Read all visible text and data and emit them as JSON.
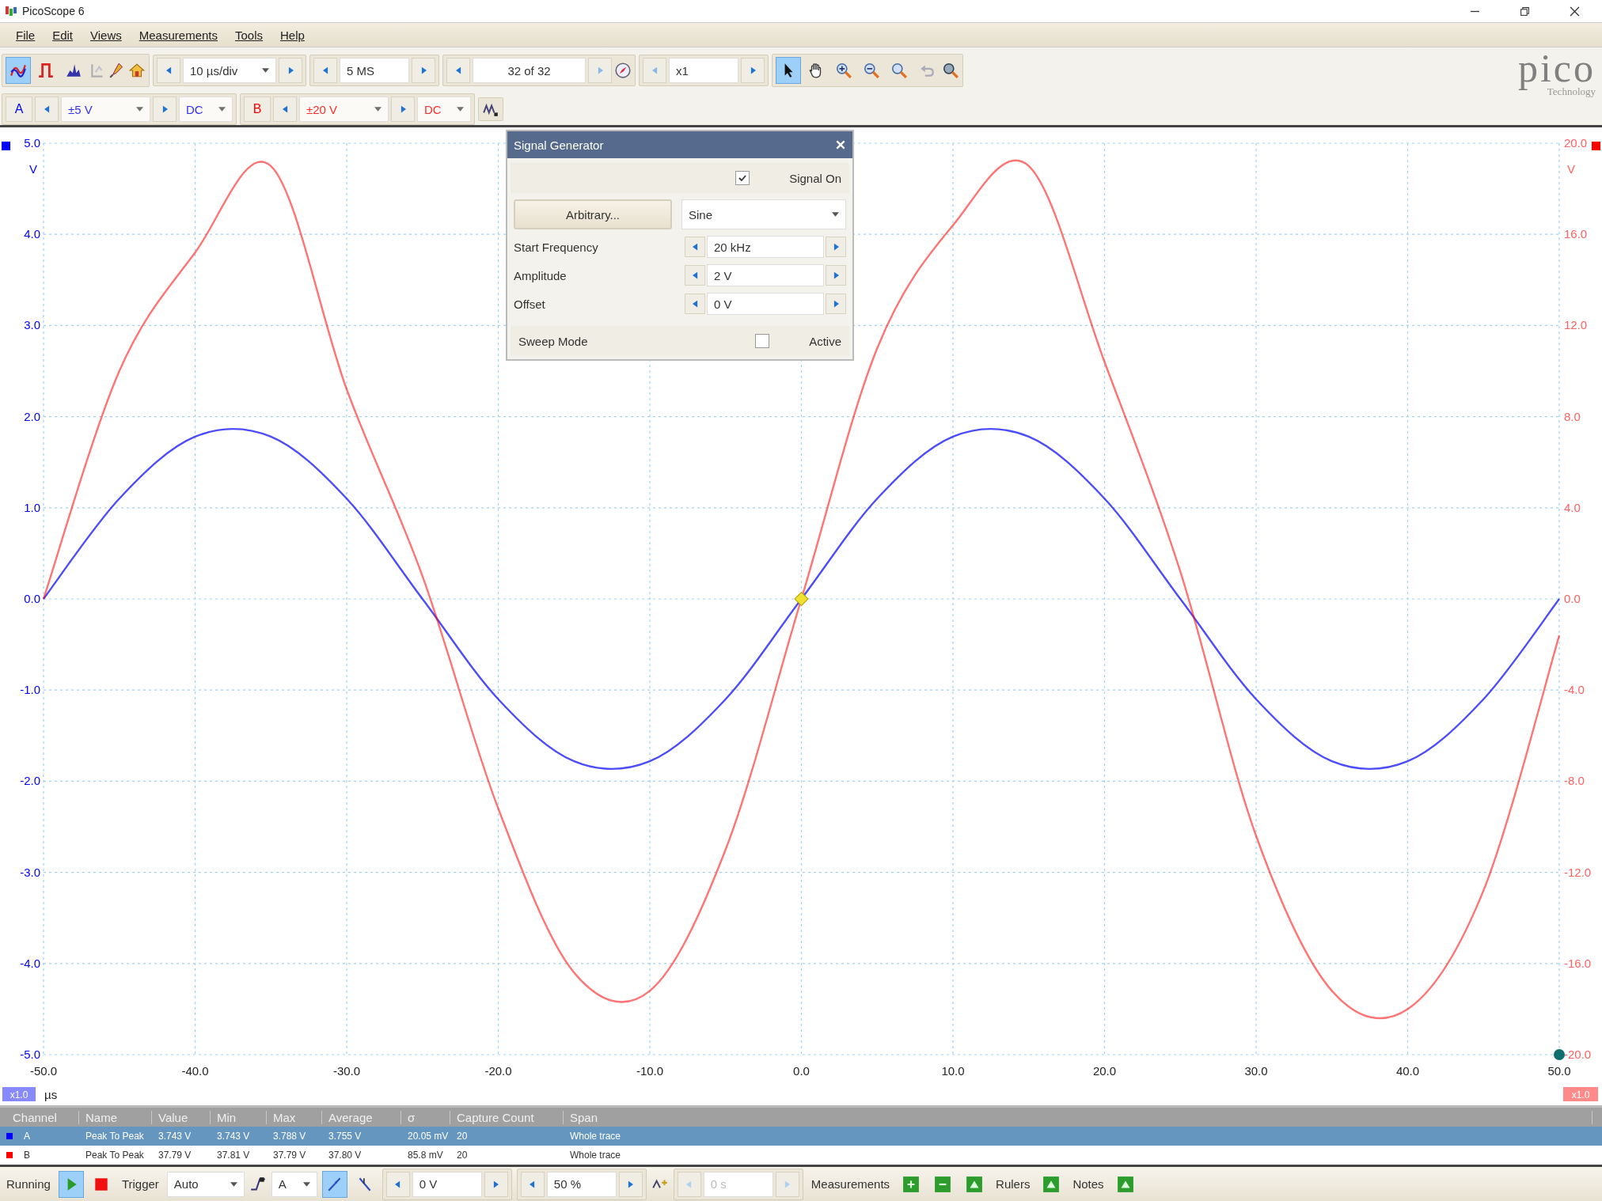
{
  "window": {
    "title": "PicoScope 6"
  },
  "menu": [
    "File",
    "Edit",
    "Views",
    "Measurements",
    "Tools",
    "Help"
  ],
  "toolbar": {
    "timebase": "10 µs/div",
    "samples": "5 MS",
    "buffer": "32 of 32",
    "zoom": "x1",
    "modes": [
      {
        "kind": "scope",
        "selected": true
      },
      {
        "kind": "persistence",
        "selected": false
      },
      {
        "kind": "spectrum",
        "selected": false
      }
    ],
    "tools": [
      {
        "kind": "pointer",
        "selected": true
      },
      {
        "kind": "hand",
        "selected": false
      },
      {
        "kind": "zoom-in",
        "selected": false
      },
      {
        "kind": "zoom-out",
        "selected": false
      },
      {
        "kind": "zoom-region",
        "selected": false
      },
      {
        "kind": "undo",
        "selected": false
      }
    ]
  },
  "logo": {
    "name": "pico",
    "tagline": "Technology"
  },
  "channels": [
    {
      "name": "A",
      "range": "±5 V",
      "coupling": "DC",
      "color": "#0000ff"
    },
    {
      "name": "B",
      "range": "±20 V",
      "coupling": "DC",
      "color": "#ff0000"
    }
  ],
  "signal_generator": {
    "title": "Signal Generator",
    "signal_on": {
      "label": "Signal On",
      "checked": true
    },
    "arbitrary_button": "Arbitrary...",
    "waveform": "Sine",
    "fields": [
      {
        "label": "Start Frequency",
        "value": "20 kHz"
      },
      {
        "label": "Amplitude",
        "value": "2 V"
      },
      {
        "label": "Offset",
        "value": "0 V"
      }
    ],
    "sweep": {
      "label": "Sweep Mode",
      "checkbox_label": "Active",
      "checked": false
    }
  },
  "graph": {
    "left_unit": "V",
    "right_unit": "V",
    "x_unit": "µs",
    "x_scale": "x1.0",
    "right_scale": "x1.0",
    "chart_data": {
      "type": "line",
      "x": [
        -50,
        -45,
        -40,
        -35,
        -30,
        -25,
        -20,
        -15,
        -10,
        -5,
        0,
        5,
        10,
        15,
        20,
        25,
        30,
        35,
        40,
        45,
        50
      ],
      "series": [
        {
          "color": "#0000ff",
          "values": [
            0,
            1.1,
            1.78,
            1.78,
            1.1,
            0,
            -1.1,
            -1.78,
            -1.78,
            -1.1,
            0,
            1.1,
            1.78,
            1.78,
            1.1,
            0,
            -1.1,
            -1.78,
            -1.78,
            -1.1,
            0
          ]
        },
        {
          "color": "#ff0000",
          "axis": "y2",
          "values": [
            0,
            10,
            15.2,
            19,
            9.2,
            1,
            -9.2,
            -16.4,
            -17.2,
            -11,
            0,
            11,
            16.4,
            19,
            10.4,
            1.2,
            -10.4,
            -17.2,
            -18,
            -12.8,
            -1.6
          ]
        }
      ],
      "grid": true,
      "xlim": [
        -50,
        50
      ],
      "ylim": [
        -5,
        5
      ],
      "y2lim": [
        -20,
        20
      ],
      "xticks": [
        {
          "value": -50,
          "label": "-50.0"
        },
        {
          "value": -40,
          "label": "-40.0"
        },
        {
          "value": -30,
          "label": "-30.0"
        },
        {
          "value": -20,
          "label": "-20.0"
        },
        {
          "value": -10,
          "label": "-10.0"
        },
        {
          "value": 0,
          "label": "0.0"
        },
        {
          "value": 10,
          "label": "10.0"
        },
        {
          "value": 20,
          "label": "20.0"
        },
        {
          "value": 30,
          "label": "30.0"
        },
        {
          "value": 40,
          "label": "40.0"
        },
        {
          "value": 50,
          "label": "50.0"
        }
      ],
      "yticks": [
        {
          "value": 5,
          "label": "5.0"
        },
        {
          "value": 4,
          "label": "4.0"
        },
        {
          "value": 3,
          "label": "3.0"
        },
        {
          "value": 2,
          "label": "2.0"
        },
        {
          "value": 1,
          "label": "1.0"
        },
        {
          "value": 0,
          "label": "0.0"
        },
        {
          "value": -1,
          "label": "-1.0"
        },
        {
          "value": -2,
          "label": "-2.0"
        },
        {
          "value": -3,
          "label": "-3.0"
        },
        {
          "value": -4,
          "label": "-4.0"
        },
        {
          "value": -5,
          "label": "-5.0"
        }
      ],
      "y2ticks": [
        {
          "value": 20,
          "label": "20.0"
        },
        {
          "value": 16,
          "label": "16.0"
        },
        {
          "value": 12,
          "label": "12.0"
        },
        {
          "value": 8,
          "label": "8.0"
        },
        {
          "value": 4,
          "label": "4.0"
        },
        {
          "value": 0,
          "label": "0.0"
        },
        {
          "value": -4,
          "label": "-4.0"
        },
        {
          "value": -8,
          "label": "-8.0"
        },
        {
          "value": -12,
          "label": "-12.0"
        },
        {
          "value": -16,
          "label": "-16.0"
        },
        {
          "value": -20,
          "label": "-20.0"
        }
      ]
    }
  },
  "measurements": {
    "columns": [
      "Channel",
      "Name",
      "Value",
      "Min",
      "Max",
      "Average",
      "σ",
      "Capture Count",
      "Span"
    ],
    "rows": [
      {
        "color": "#0000ff",
        "selected": true,
        "cells": [
          "A",
          "Peak To Peak",
          "3.743 V",
          "3.743 V",
          "3.788 V",
          "3.755 V",
          "20.05 mV",
          "20",
          "Whole trace"
        ]
      },
      {
        "color": "#ff0000",
        "selected": false,
        "cells": [
          "B",
          "Peak To Peak",
          "37.79 V",
          "37.81 V",
          "37.79 V",
          "37.80 V",
          "85.8 mV",
          "20",
          "Whole trace"
        ]
      }
    ]
  },
  "status_bar": {
    "run_label": "Running",
    "trigger_label": "Trigger",
    "trigger_mode": "Auto",
    "trigger_channel": "A",
    "threshold": "0 V",
    "pretrigger": "50 %",
    "delay": {
      "value": "0 s",
      "disabled": true
    },
    "edges": [
      {
        "kind": "rising",
        "selected": true
      },
      {
        "kind": "falling",
        "selected": false
      }
    ],
    "measurements_label": "Measurements",
    "rulers_label": "Rulers",
    "notes_label": "Notes"
  }
}
